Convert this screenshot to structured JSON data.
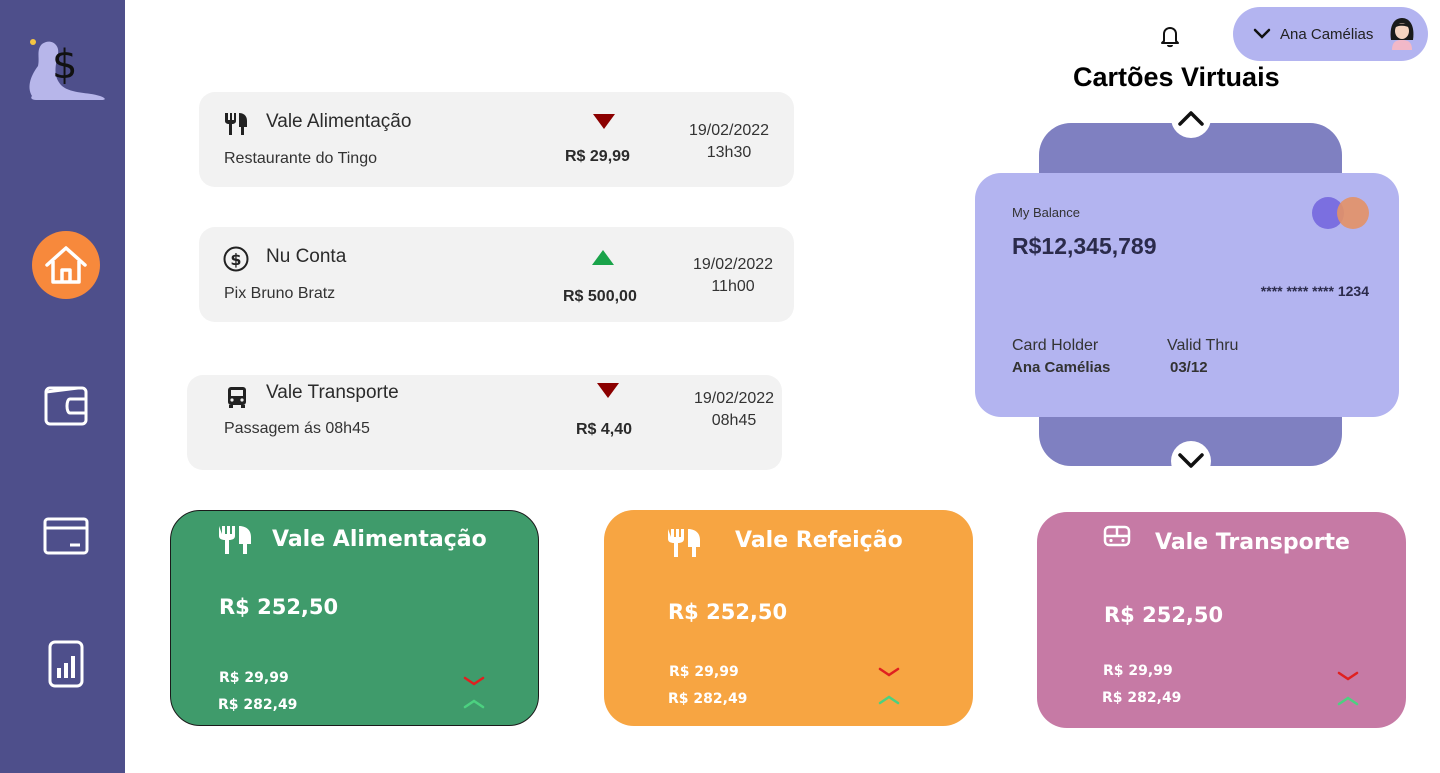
{
  "header": {
    "user_name": "Ana Camélias"
  },
  "sidebar": {
    "items": [
      {
        "icon": "home-icon",
        "active": true
      },
      {
        "icon": "wallet-icon",
        "active": false
      },
      {
        "icon": "card-icon",
        "active": false
      },
      {
        "icon": "bar-chart-icon",
        "active": false
      }
    ],
    "accent": "#f7893c",
    "background": "#4e4f8b"
  },
  "transactions": [
    {
      "icon": "cutlery-icon",
      "title": "Vale Alimentação",
      "description": "Restaurante do Tingo",
      "direction": "down",
      "amount": "R$ 29,99",
      "date": "19/02/2022",
      "time": "13h30"
    },
    {
      "icon": "dollar-circle-icon",
      "title": "Nu Conta",
      "description": "Pix Bruno Bratz",
      "direction": "up",
      "amount": "R$ 500,00",
      "date": "19/02/2022",
      "time": "11h00"
    },
    {
      "icon": "bus-icon",
      "title": "Vale Transporte",
      "description": "Passagem ás 08h45",
      "direction": "down",
      "amount": "R$ 4,40",
      "date": "19/02/2022",
      "time": "08h45"
    }
  ],
  "virtual_cards": {
    "title": "Cartões Virtuais",
    "card": {
      "balance_label": "My Balance",
      "balance": "R$12,345,789",
      "number": "**** **** **** 1234",
      "holder_label": "Card Holder",
      "holder": "Ana Camélias",
      "valid_label": "Valid Thru",
      "valid": "03/12"
    }
  },
  "benefits": [
    {
      "icon": "cutlery-icon",
      "title": "Vale Alimentação",
      "balance": "R$ 252,50",
      "out": "R$ 29,99",
      "in": "R$ 282,49",
      "color": "#3f9b6b"
    },
    {
      "icon": "cutlery-icon",
      "title": "Vale Refeição",
      "balance": "R$ 252,50",
      "out": "R$ 29,99",
      "in": "R$ 282,49",
      "color": "#f7a542"
    },
    {
      "icon": "bus-icon",
      "title": "Vale Transporte",
      "balance": "R$ 252,50",
      "out": "R$ 29,99",
      "in": "R$ 282,49",
      "color": "#c67aa5"
    }
  ],
  "colors": {
    "down": "#8b0000",
    "up": "#1aa34a",
    "down_chevron": "#e02020",
    "up_chevron": "#4cd180"
  }
}
